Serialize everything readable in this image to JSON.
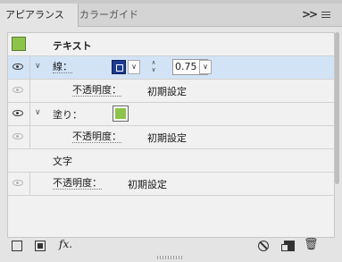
{
  "tabs": [
    {
      "label": "アピアランス",
      "active": true
    },
    {
      "label": "カラーガイド",
      "active": false
    }
  ],
  "panel_controls": {
    "collapse": ">>",
    "menu_icon": "hamburger-menu-icon"
  },
  "header_row": {
    "label": "テキスト",
    "swatch_color": "#8cc34a"
  },
  "rows": {
    "stroke": {
      "label": "線：",
      "color": "#1e3b93",
      "weight": "0.75 pt"
    },
    "stroke_opacity": {
      "label": "不透明度：",
      "value": "初期設定"
    },
    "fill": {
      "label": "塗り：",
      "color": "#8cc34a"
    },
    "fill_opacity": {
      "label": "不透明度：",
      "value": "初期設定"
    },
    "characters": {
      "label": "文字"
    },
    "text_opacity": {
      "label": "不透明度：",
      "value": "初期設定"
    }
  },
  "bottom_toolbar": {
    "fx_label": "fx."
  }
}
